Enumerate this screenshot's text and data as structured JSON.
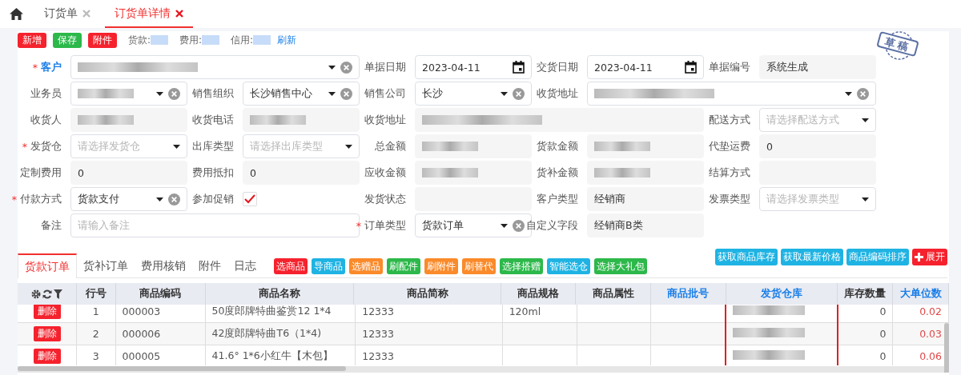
{
  "top_tabs": [
    {
      "label": "订货单",
      "selected": false
    },
    {
      "label": "订货单详情",
      "selected": true
    }
  ],
  "toolbar": {
    "buttons": [
      {
        "label": "新增",
        "color": "#f5222d"
      },
      {
        "label": "保存",
        "color": "#2cb84a"
      },
      {
        "label": "附件",
        "color": "#f5222d"
      }
    ],
    "balances": [
      {
        "label": "货款:",
        "redacted": true
      },
      {
        "label": "费用:",
        "redacted": true
      },
      {
        "label": "信用:",
        "redacted": true
      }
    ],
    "refresh_link": "刷新"
  },
  "stamp": "草稿",
  "form": [
    {
      "label": "客户",
      "required_mark": "*",
      "emphasized": true,
      "kind": "select",
      "redacted": true,
      "clearable": true
    },
    {
      "label": "单据日期",
      "kind": "date",
      "value": "2023-04-11"
    },
    {
      "label": "交货日期",
      "kind": "date",
      "value": "2023-04-11"
    },
    {
      "label": "单据编号",
      "kind": "readonly",
      "value": "系统生成"
    },
    {
      "label": "业务员",
      "kind": "select",
      "redacted": true,
      "clearable": true
    },
    {
      "label": "销售组织",
      "kind": "select",
      "value": "长沙销售中心",
      "clearable": true
    },
    {
      "label": "销售公司",
      "kind": "select",
      "value": "长沙",
      "clearable": true
    },
    {
      "label": "收货地址",
      "kind": "select",
      "redacted": true,
      "clearable": true
    },
    {
      "label": "收货人",
      "kind": "readonly",
      "redacted": true
    },
    {
      "label": "收货电话",
      "kind": "readonly",
      "redacted": true
    },
    {
      "label": "收货地址",
      "kind": "readonly",
      "redacted": true
    },
    {
      "label": "配送方式",
      "kind": "select",
      "placeholder": "请选择配送方式"
    },
    {
      "label": "发货仓",
      "required_mark": "*",
      "kind": "select",
      "placeholder": "请选择发货仓"
    },
    {
      "label": "出库类型",
      "kind": "select",
      "placeholder": "请选择出库类型"
    },
    {
      "label": "总金额",
      "kind": "readonly",
      "redacted": true
    },
    {
      "label": "货款金额",
      "kind": "readonly",
      "redacted": true
    },
    {
      "label": "代垫运费",
      "kind": "readonly",
      "value": "0"
    },
    {
      "label": "定制费用",
      "kind": "readonly",
      "value": "0"
    },
    {
      "label": "费用抵扣",
      "kind": "readonly",
      "value": "0"
    },
    {
      "label": "应收金额",
      "kind": "readonly",
      "redacted": true
    },
    {
      "label": "货补金额",
      "kind": "readonly",
      "redacted": true
    },
    {
      "label": "结算方式",
      "kind": "readonly"
    },
    {
      "label": "付款方式",
      "required_mark": "*",
      "kind": "select",
      "value": "货款支付",
      "clearable": true
    },
    {
      "label": "参加促销",
      "kind": "checkbox",
      "checked": true
    },
    {
      "label": "发货状态",
      "kind": "readonly"
    },
    {
      "label": "客户类型",
      "kind": "readonly",
      "value": "经销商"
    },
    {
      "label": "发票类型",
      "kind": "select",
      "placeholder": "请选择发票类型"
    },
    {
      "label": "备注",
      "kind": "input",
      "placeholder": "请输入备注"
    },
    {
      "label": "订单类型",
      "required_mark": "*",
      "kind": "select",
      "value": "货款订单",
      "clearable": true
    },
    {
      "label": "自定义字段",
      "kind": "readonly",
      "value": "经销商B类"
    }
  ],
  "detail_tabs": [
    {
      "label": "货款订单",
      "selected": true
    },
    {
      "label": "货补订单",
      "selected": false
    },
    {
      "label": "费用核销",
      "selected": false
    },
    {
      "label": "附件",
      "selected": false
    },
    {
      "label": "日志",
      "selected": false
    }
  ],
  "action_buttons": [
    {
      "label": "选商品",
      "color": "#f5222d"
    },
    {
      "label": "导商品",
      "color": "#1fb3e3"
    },
    {
      "label": "选赠品",
      "color": "#fa8a2a"
    },
    {
      "label": "刷配件",
      "color": "#2cb84a"
    },
    {
      "label": "刷附件",
      "color": "#fa8a2a"
    },
    {
      "label": "刷替代",
      "color": "#fa8a2a"
    },
    {
      "label": "选择搭赠",
      "color": "#2cb84a"
    },
    {
      "label": "智能选仓",
      "color": "#1fb3e3"
    },
    {
      "label": "选择大礼包",
      "color": "#2cb84a"
    }
  ],
  "right_buttons": [
    {
      "label": "获取商品库存",
      "color": "#1fb3e3",
      "kind": "plain"
    },
    {
      "label": "获取最新价格",
      "color": "#1fb3e3",
      "kind": "plain"
    },
    {
      "label": "商品编码排序",
      "color": "#1fb3e3",
      "kind": "plain"
    },
    {
      "label": "展开",
      "color": "#f5222d",
      "kind": "expand"
    }
  ],
  "table": {
    "columns": [
      {
        "label": "行号",
        "editable": false,
        "highlighted": false
      },
      {
        "label": "商品编码",
        "editable": false,
        "highlighted": false
      },
      {
        "label": "商品名称",
        "editable": false,
        "highlighted": false
      },
      {
        "label": "商品简称",
        "editable": false,
        "highlighted": false
      },
      {
        "label": "商品规格",
        "editable": false,
        "highlighted": false
      },
      {
        "label": "商品属性",
        "editable": false,
        "highlighted": false
      },
      {
        "label": "商品批号",
        "editable": true,
        "highlighted": false
      },
      {
        "label": "发货仓库",
        "editable": true,
        "highlighted": true
      },
      {
        "label": "库存数量",
        "editable": false,
        "highlighted": false
      },
      {
        "label": "大单位数",
        "editable": true,
        "highlighted": false
      }
    ],
    "rows": [
      {
        "delete": "删除",
        "cells": [
          "1",
          "000003",
          "50度郎牌特曲鉴赏12 1*4",
          "12333",
          "120ml",
          "",
          "",
          null,
          "0",
          "0.02"
        ]
      },
      {
        "delete": "删除",
        "cells": [
          "2",
          "000006",
          "42度郎牌特曲T6（1*4)",
          "12333",
          "",
          "",
          "",
          null,
          "0",
          "0.03"
        ]
      },
      {
        "delete": "删除",
        "cells": [
          "3",
          "000005",
          "41.6° 1*6小红牛【木包】",
          "12333",
          "",
          "",
          "",
          null,
          "0",
          "0.06"
        ]
      }
    ]
  }
}
